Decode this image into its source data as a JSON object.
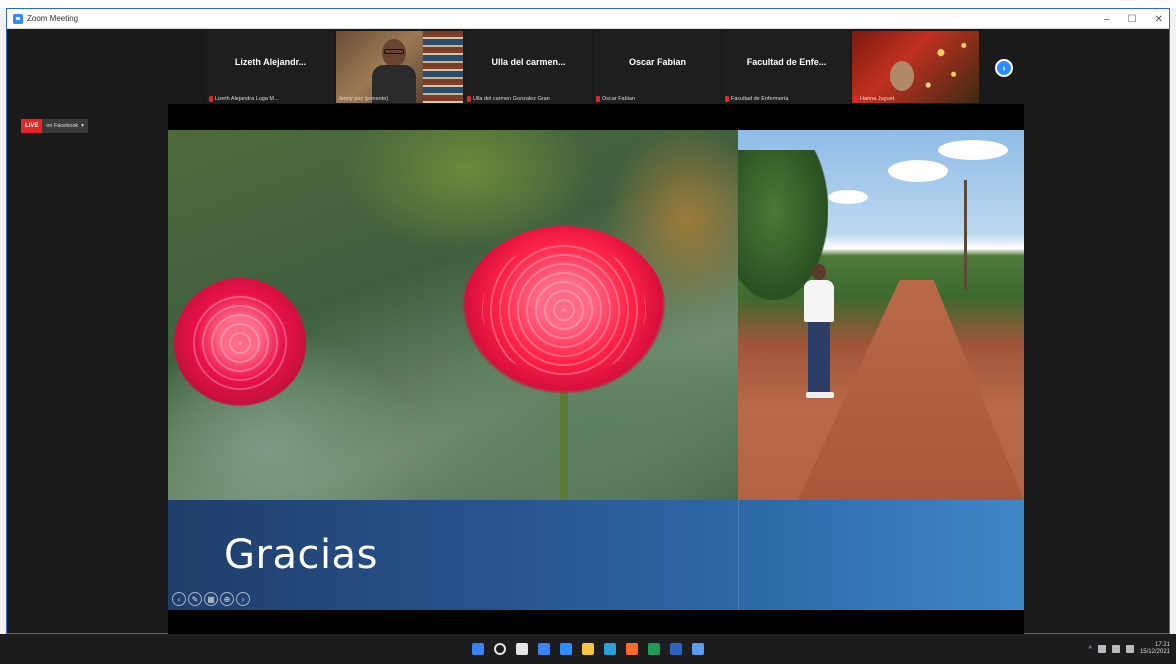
{
  "window": {
    "title": "Zoom Meeting",
    "controls": [
      "–",
      "☐",
      "✕"
    ]
  },
  "participants": [
    {
      "name": "Lizeth Alejandr...",
      "footer": "Lizeth Alejandra Luga M...",
      "video": false
    },
    {
      "name": "",
      "footer": "Jenny paz (ponente)",
      "video": true
    },
    {
      "name": "Ulla del carmen...",
      "footer": "Ulla del carmen Gonzalez Gran",
      "video": false
    },
    {
      "name": "Oscar Fabian",
      "footer": "Oscar Fabian",
      "video": false
    },
    {
      "name": "Facultad de Enfe...",
      "footer": "Facultad de Enfermería",
      "video": false
    },
    {
      "name": "",
      "footer": "Hanna Juguet",
      "video": true
    }
  ],
  "live": {
    "badge": "LIVE",
    "platform": "on Facebook",
    "caret": "▾"
  },
  "slide": {
    "title": "Gracias"
  },
  "taskbar": {
    "icons": [
      {
        "name": "start-icon",
        "color": "#3b82f6"
      },
      {
        "name": "search-icon",
        "color": "#e5e5e5"
      },
      {
        "name": "taskview-icon",
        "color": "#e5e5e5"
      },
      {
        "name": "widgets-icon",
        "color": "#3b82f6"
      },
      {
        "name": "zoom-icon",
        "color": "#2d8cff"
      },
      {
        "name": "file-explorer-icon",
        "color": "#f5c542"
      },
      {
        "name": "edge-icon",
        "color": "#2aa3d8"
      },
      {
        "name": "firefox-icon",
        "color": "#ff6b2b"
      },
      {
        "name": "excel-icon",
        "color": "#1f9d55"
      },
      {
        "name": "word-icon",
        "color": "#2b64c5"
      },
      {
        "name": "store-icon",
        "color": "#5a9cf0"
      }
    ],
    "clock_time": "17:21 ",
    "clock_date": "15/12/2021"
  }
}
